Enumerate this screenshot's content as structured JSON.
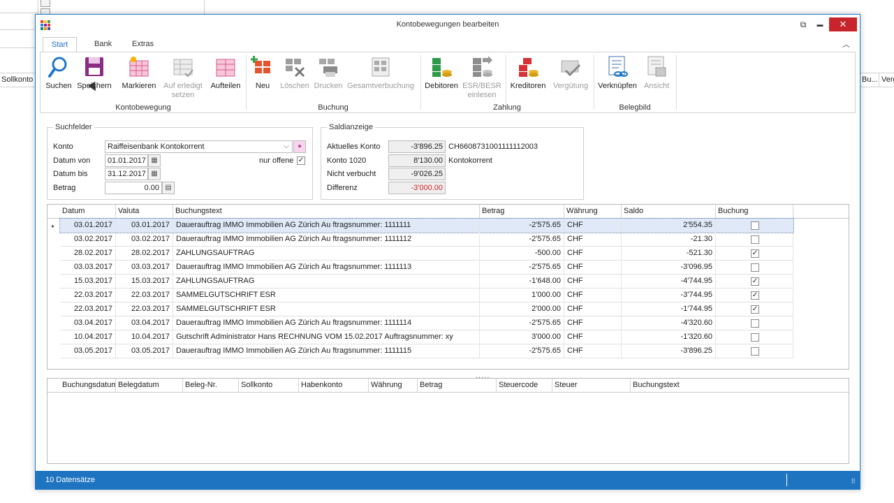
{
  "background": {
    "left_label": "Sollkonto",
    "right_label_1": "Bu...",
    "right_label_2": "Verg"
  },
  "window": {
    "title": "Kontobewegungen bearbeiten",
    "restore_glyph": "⧉",
    "minimize_glyph": "▬",
    "close_glyph": "✕"
  },
  "ribbon": {
    "tabs": [
      {
        "label": "Start",
        "active": true
      },
      {
        "label": "Bank",
        "active": false
      },
      {
        "label": "Extras",
        "active": false
      }
    ],
    "collapse_glyph": "︿",
    "groups": {
      "kontobewegung": "Kontobewegung",
      "buchung": "Buchung",
      "zahlung": "Zahlung",
      "belegbild": "Belegbild"
    },
    "buttons": {
      "suchen": "Suchen",
      "speichern": "Speichern",
      "markieren": "Markieren",
      "auf_erledigt_1": "Auf erledigt",
      "auf_erledigt_2": "setzen",
      "aufteilen": "Aufteilen",
      "neu": "Neu",
      "loeschen": "Löschen",
      "drucken": "Drucken",
      "gesamtverbuchung": "Gesamtverbuchung",
      "debitoren": "Debitoren",
      "esr_1": "ESR/BESR",
      "esr_2": "einlesen",
      "kreditoren": "Kreditoren",
      "verguetung": "Vergütung",
      "verknuepfen": "Verknüpfen",
      "ansicht": "Ansicht"
    }
  },
  "suchfelder": {
    "legend": "Suchfelder",
    "konto_label": "Konto",
    "konto_value": "Raiffeisenbank Kontokorrent",
    "datum_von_label": "Datum von",
    "datum_von_value": "01.01.2017",
    "datum_bis_label": "Datum bis",
    "datum_bis_value": "31.12.2017",
    "betrag_label": "Betrag",
    "betrag_value": "0.00",
    "nur_offene_label": "nur offene",
    "nur_offene_checked": "✓"
  },
  "saldianzeige": {
    "legend": "Saldianzeige",
    "aktuelles_konto_label": "Aktuelles Konto",
    "aktuelles_konto_value": "-3'896.25",
    "iban": "CH6608731001111112003",
    "konto_1020_label": "Konto 1020",
    "konto_1020_value": "8'130.00",
    "konto_1020_name": "Kontokorrent",
    "nicht_verbucht_label": "Nicht verbucht",
    "nicht_verbucht_value": "-9'026.25",
    "differenz_label": "Differenz",
    "differenz_value": "-3'000.00"
  },
  "grid_main": {
    "columns": [
      "Datum",
      "Valuta",
      "Buchungstext",
      "Betrag",
      "Währung",
      "Saldo",
      "Buchung"
    ],
    "rows": [
      {
        "datum": "03.01.2017",
        "valuta": "03.01.2017",
        "text": "Dauerauftrag IMMO Immobilien AG Zürich Au ftragsnummer: 1111111",
        "betrag": "-2'575.65",
        "waehrung": "CHF",
        "saldo": "2'554.35",
        "buchung": ""
      },
      {
        "datum": "03.02.2017",
        "valuta": "03.02.2017",
        "text": "Dauerauftrag IMMO Immobilien AG Zürich Au ftragsnummer: 1111112",
        "betrag": "-2'575.65",
        "waehrung": "CHF",
        "saldo": "-21.30",
        "buchung": ""
      },
      {
        "datum": "28.02.2017",
        "valuta": "28.02.2017",
        "text": "ZAHLUNGSAUFTRAG",
        "betrag": "-500.00",
        "waehrung": "CHF",
        "saldo": "-521.30",
        "buchung": "✓"
      },
      {
        "datum": "03.03.2017",
        "valuta": "03.03.2017",
        "text": "Dauerauftrag IMMO Immobilien AG Zürich Au ftragsnummer: 1111113",
        "betrag": "-2'575.65",
        "waehrung": "CHF",
        "saldo": "-3'096.95",
        "buchung": ""
      },
      {
        "datum": "15.03.2017",
        "valuta": "15.03.2017",
        "text": "ZAHLUNGSAUFTRAG",
        "betrag": "-1'648.00",
        "waehrung": "CHF",
        "saldo": "-4'744.95",
        "buchung": "✓"
      },
      {
        "datum": "22.03.2017",
        "valuta": "22.03.2017",
        "text": "SAMMELGUTSCHRIFT ESR",
        "betrag": "1'000.00",
        "waehrung": "CHF",
        "saldo": "-3'744.95",
        "buchung": "✓"
      },
      {
        "datum": "22.03.2017",
        "valuta": "22.03.2017",
        "text": "SAMMELGUTSCHRIFT ESR",
        "betrag": "2'000.00",
        "waehrung": "CHF",
        "saldo": "-1'744.95",
        "buchung": "✓"
      },
      {
        "datum": "03.04.2017",
        "valuta": "03.04.2017",
        "text": "Dauerauftrag IMMO Immobilien AG Zürich Au ftragsnummer: 1111114",
        "betrag": "-2'575.65",
        "waehrung": "CHF",
        "saldo": "-4'320.60",
        "buchung": ""
      },
      {
        "datum": "10.04.2017",
        "valuta": "10.04.2017",
        "text": "Gutschrift Administrator Hans RECHNUNG VOM 15.02.2017  Auftragsnummer: xy",
        "betrag": "3'000.00",
        "waehrung": "CHF",
        "saldo": "-1'320.60",
        "buchung": ""
      },
      {
        "datum": "03.05.2017",
        "valuta": "03.05.2017",
        "text": "Dauerauftrag IMMO Immobilien AG Zürich Au ftragsnummer: 1111115",
        "betrag": "-2'575.65",
        "waehrung": "CHF",
        "saldo": "-3'896.25",
        "buchung": ""
      }
    ],
    "row_indicator": "▸"
  },
  "splitter": ".....",
  "grid_detail": {
    "columns": [
      "Buchungsdatum",
      "Belegdatum",
      "Beleg-Nr.",
      "Sollkonto",
      "Habenkonto",
      "Währung",
      "Betrag",
      "Steuercode",
      "Steuer",
      "Buchungstext"
    ]
  },
  "statusbar": {
    "count": "10 Datensätze",
    "grip": "⠿"
  },
  "colors": {
    "accent": "#1e74c0",
    "close": "#c7252b",
    "negative": "#d02020",
    "selected_row": "#dfe9f7"
  }
}
